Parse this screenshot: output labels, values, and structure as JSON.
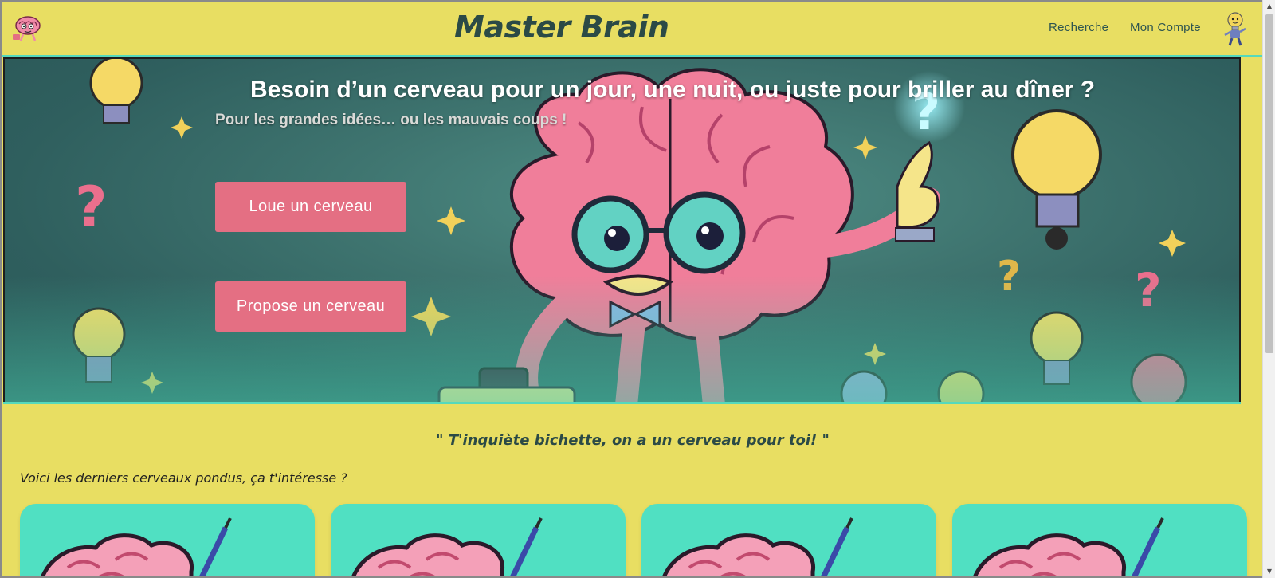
{
  "header": {
    "brand": "Master Brain",
    "nav": [
      {
        "label": "Recherche"
      },
      {
        "label": "Mon Compte"
      }
    ]
  },
  "hero": {
    "title": "Besoin d’un cerveau pour un jour, une nuit, ou juste pour briller au dîner ?",
    "subtitle": "Pour les grandes idées… ou les mauvais coups !",
    "buttons": {
      "rent": "Loue un cerveau",
      "offer": "Propose un cerveau"
    }
  },
  "main": {
    "quote": "\" T'inquiète bichette, on a un cerveau pour toi! \"",
    "intro": "Voici les derniers cerveaux pondus, ça t'intéresse ?",
    "card_count": 4
  },
  "colors": {
    "background": "#e8de62",
    "accent_teal": "#50e0c2",
    "button_pink": "#e46f83",
    "text_dark": "#2b4a46"
  },
  "icons": {
    "logo": "brain-logo-icon",
    "avatar": "lightbulb-character-icon",
    "scroll_up": "arrow-up-icon",
    "scroll_down": "arrow-down-icon"
  }
}
